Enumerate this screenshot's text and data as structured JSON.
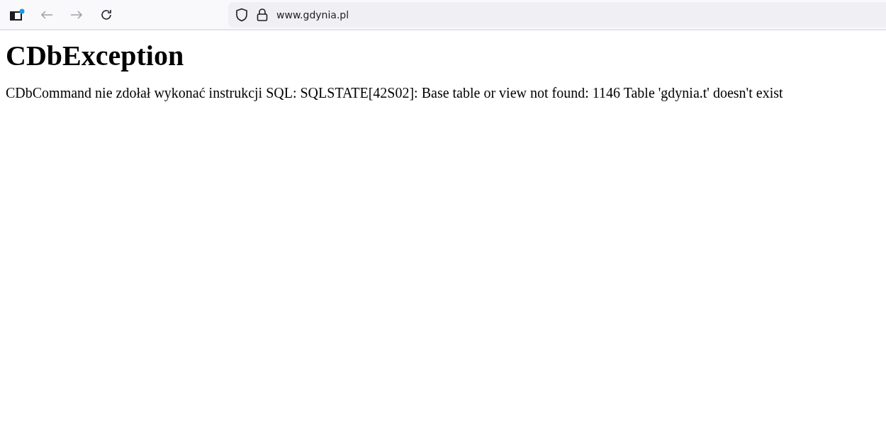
{
  "browser": {
    "url": "www.gdynia.pl"
  },
  "page": {
    "heading": "CDbException",
    "message": "CDbCommand nie zdołał wykonać instrukcji SQL: SQLSTATE[42S02]: Base table or view not found: 1146 Table 'gdynia.t' doesn't exist"
  }
}
